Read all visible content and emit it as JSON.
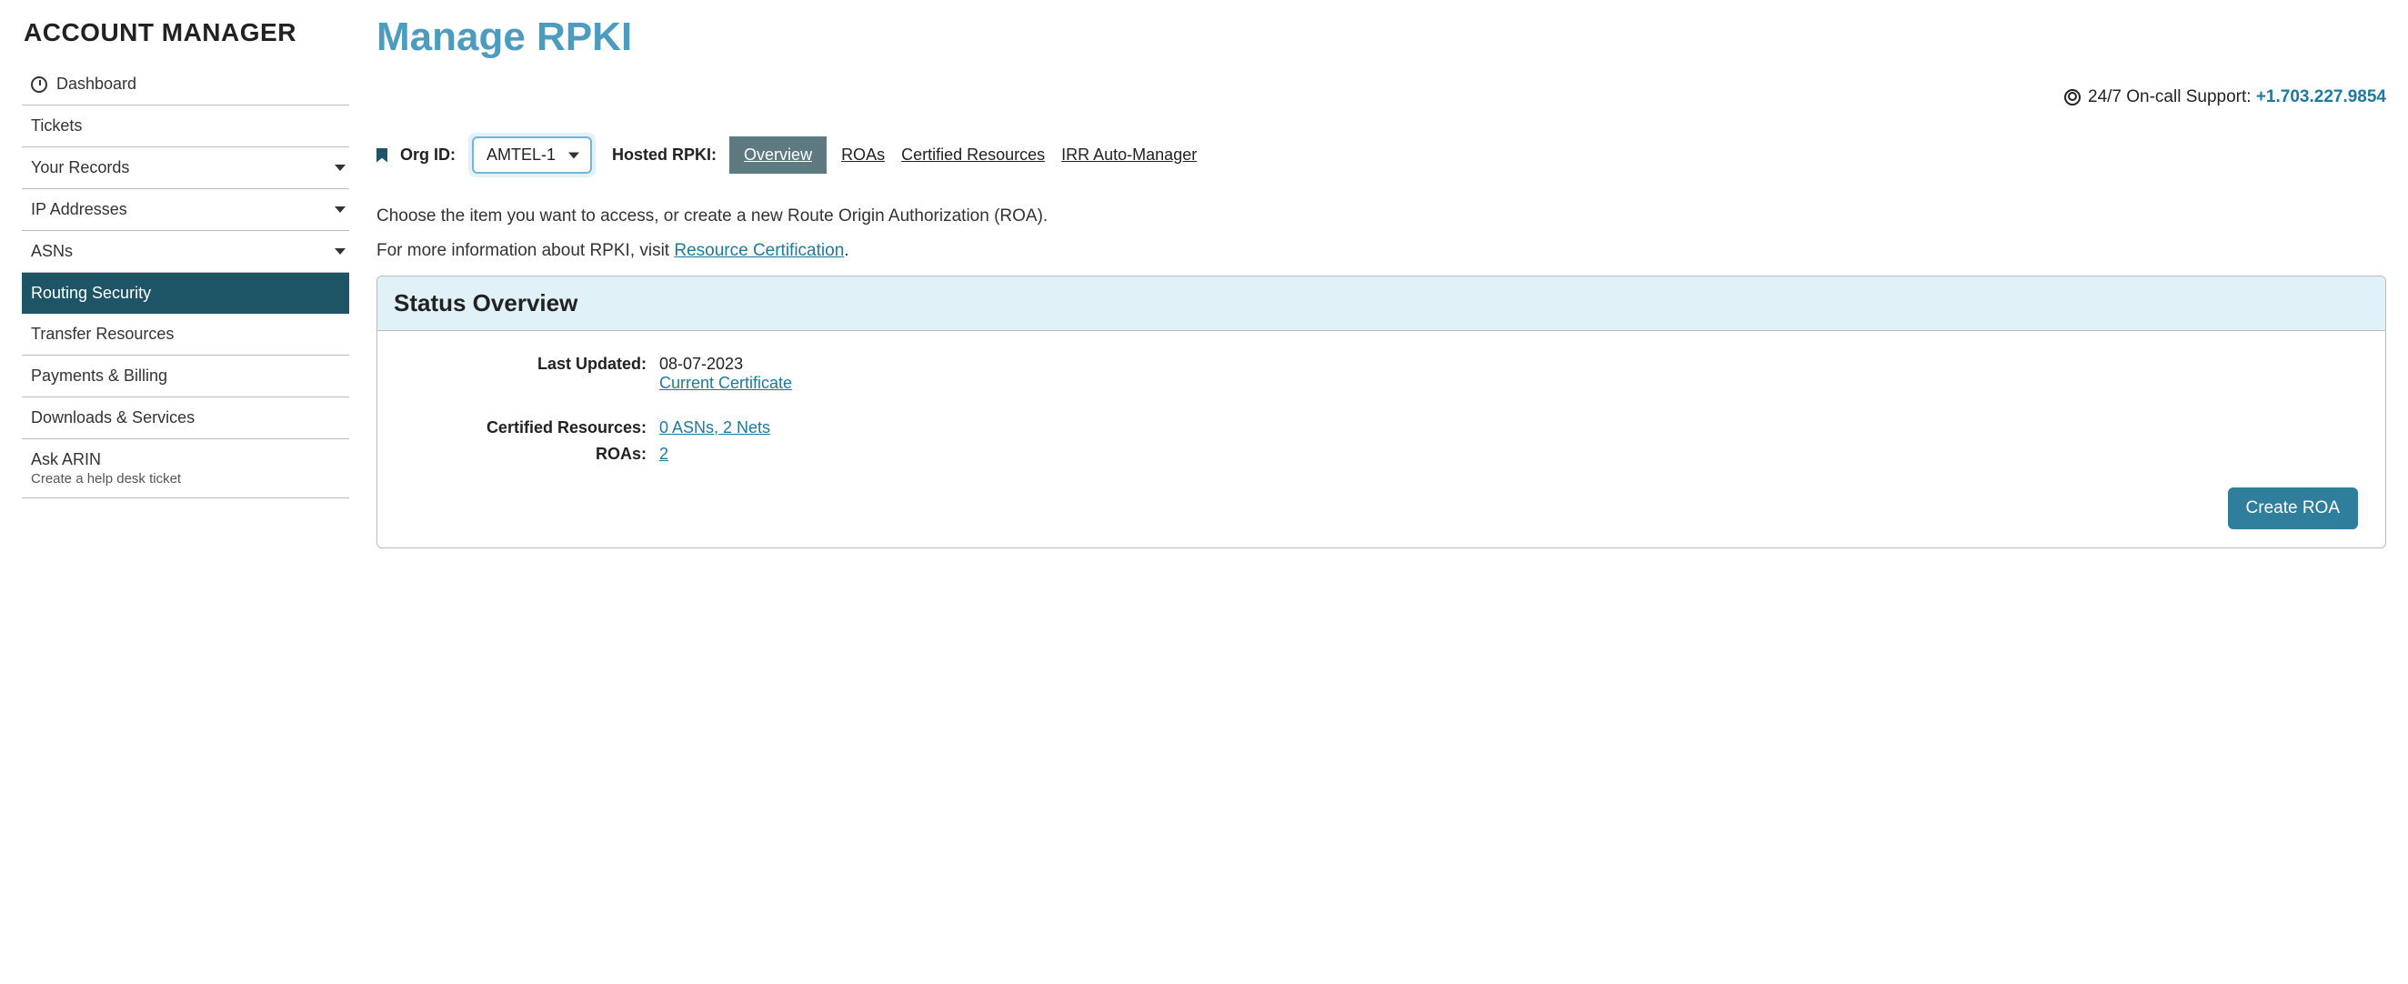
{
  "sidebar": {
    "title": "ACCOUNT MANAGER",
    "items": [
      {
        "label": "Dashboard",
        "icon": "dashboard"
      },
      {
        "label": "Tickets"
      },
      {
        "label": "Your Records",
        "caret": true
      },
      {
        "label": "IP Addresses",
        "caret": true
      },
      {
        "label": "ASNs",
        "caret": true
      },
      {
        "label": "Routing Security",
        "active": true
      },
      {
        "label": "Transfer Resources"
      },
      {
        "label": "Payments & Billing"
      },
      {
        "label": "Downloads & Services"
      },
      {
        "label": "Ask ARIN",
        "sub": "Create a help desk ticket"
      }
    ]
  },
  "page": {
    "title": "Manage RPKI",
    "support_label": "24/7 On-call Support: ",
    "support_phone": "+1.703.227.9854"
  },
  "toolbar": {
    "org_label": "Org ID:",
    "org_selected": "AMTEL-1",
    "hosted_label": "Hosted RPKI:",
    "tabs": [
      {
        "label": "Overview",
        "active": true
      },
      {
        "label": "ROAs"
      },
      {
        "label": "Certified Resources"
      },
      {
        "label": "IRR Auto-Manager"
      }
    ]
  },
  "intro": {
    "line1": "Choose the item you want to access, or create a new Route Origin Authorization (ROA).",
    "line2_prefix": "For more information about RPKI, visit ",
    "line2_link": "Resource Certification",
    "line2_suffix": "."
  },
  "panel": {
    "title": "Status Overview",
    "last_updated_label": "Last Updated:",
    "last_updated_value": "08-07-2023",
    "current_cert_link": "Current Certificate",
    "certified_label": "Certified Resources:",
    "certified_value": "0 ASNs, 2 Nets",
    "roas_label": "ROAs:",
    "roas_value": "2",
    "create_button": "Create ROA"
  }
}
